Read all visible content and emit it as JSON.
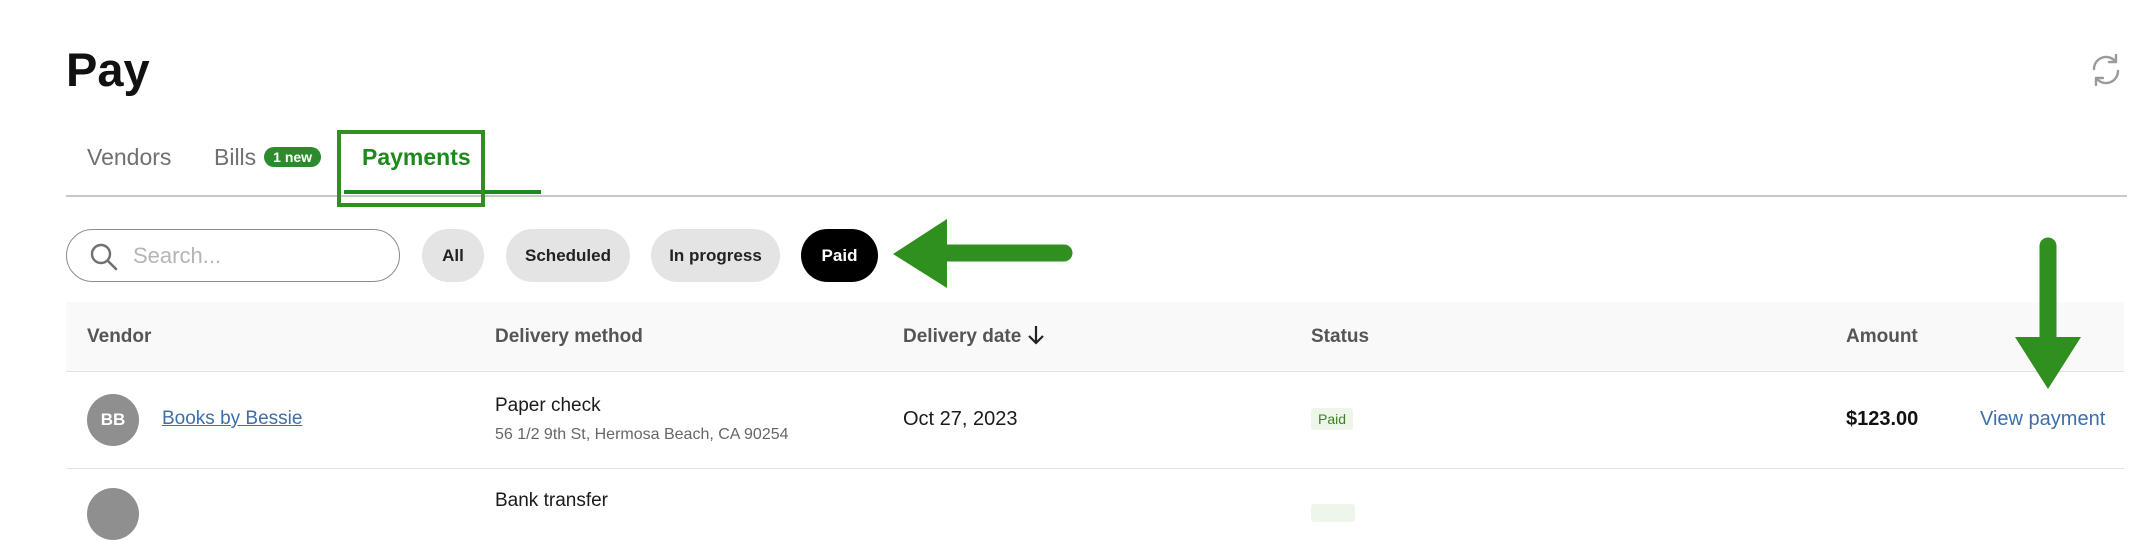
{
  "page": {
    "title": "Pay",
    "refresh_icon": "refresh-icon"
  },
  "tabs": [
    {
      "label": "Vendors",
      "active": false
    },
    {
      "label": "Bills",
      "active": false,
      "badge": "1 new"
    },
    {
      "label": "Payments",
      "active": true
    }
  ],
  "search": {
    "placeholder": "Search...",
    "value": "",
    "icon": "search-icon"
  },
  "filters": [
    {
      "label": "All",
      "selected": false
    },
    {
      "label": "Scheduled",
      "selected": false
    },
    {
      "label": "In progress",
      "selected": false
    },
    {
      "label": "Paid",
      "selected": true
    }
  ],
  "table": {
    "columns": [
      "Vendor",
      "Delivery method",
      "Delivery date",
      "Status",
      "Amount"
    ],
    "sort_icon": "arrow-down-icon",
    "rows": [
      {
        "initials": "BB",
        "vendor": "Books by Bessie",
        "method": "Paper check",
        "address": "56 1/2 9th St, Hermosa Beach, CA 90254",
        "date": "Oct 27, 2023",
        "status": "Paid",
        "amount": "$123.00",
        "action": "View payment"
      },
      {
        "initials": "",
        "vendor": "",
        "method": "Bank transfer",
        "address": "",
        "date": "",
        "status": "",
        "amount": "",
        "action": ""
      }
    ]
  },
  "colors": {
    "accent_green": "#1e8a1e",
    "annotation_green": "#2f8f1f",
    "link_blue": "#3d6fa6",
    "paid_badge_bg": "#eef6e9",
    "selected_filter_bg": "#000000"
  }
}
